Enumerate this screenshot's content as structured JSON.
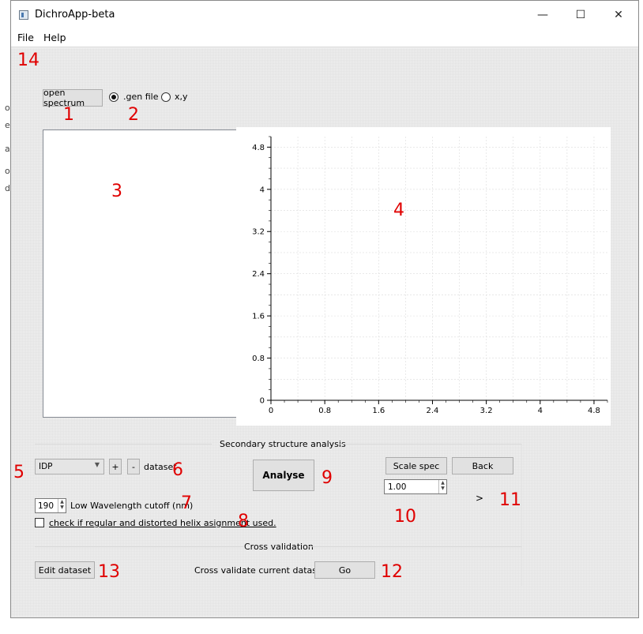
{
  "window": {
    "title": "DichroApp-beta",
    "minimize": "—",
    "maximize": "☐",
    "close": "✕"
  },
  "menu": {
    "file": "File",
    "help": "Help"
  },
  "open_spectrum": "open spectrum",
  "radio": {
    "gen_file": ".gen file",
    "xy": "x,y",
    "selected": "gen_file"
  },
  "secondary": {
    "title": "Secondary structure analysis",
    "dataset_combo": "IDP",
    "plus": "+",
    "minus": "-",
    "dataset_label": "dataset",
    "analyse": "Analyse",
    "cutoff_value": "190",
    "cutoff_label": "Low Wavelength cutoff (nm)",
    "helix_check": "check if regular and distorted helix asignment used.",
    "scale_spec": "Scale spec",
    "back": "Back",
    "scale_value": "1.00",
    "arrow_label": ">"
  },
  "cross": {
    "title": "Cross validation",
    "edit_dataset": "Edit dataset",
    "label": "Cross validate current dataset",
    "go": "Go"
  },
  "annotations": [
    "1",
    "2",
    "3",
    "4",
    "5",
    "6",
    "7",
    "8",
    "9",
    "10",
    "11",
    "12",
    "13",
    "14"
  ],
  "chart_data": {
    "type": "line",
    "series": [],
    "xlim": [
      0,
      5.0
    ],
    "ylim": [
      0,
      5.0
    ],
    "x_ticks": [
      "0",
      "0.8",
      "1.6",
      "2.4",
      "3.2",
      "4",
      "4.8"
    ],
    "y_ticks": [
      "0",
      "0.8",
      "1.6",
      "2.4",
      "3.2",
      "4",
      "4.8"
    ],
    "grid": true,
    "title": "",
    "xlabel": "",
    "ylabel": ""
  },
  "colors": {
    "annotation": "#e00000",
    "window_bg": "#f0f0f0",
    "grid": "#dcdcdc"
  }
}
